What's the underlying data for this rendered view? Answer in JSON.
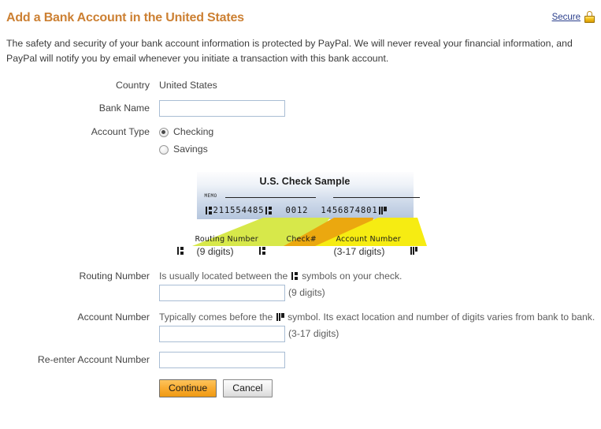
{
  "header": {
    "title": "Add a Bank Account in the United States",
    "secure_label": "Secure",
    "lock_icon": "padlock-icon"
  },
  "intro": {
    "text": "The safety and security of your bank account information is protected by PayPal. We will never reveal your financial information, and PayPal will notify you by email whenever you initiate a transaction with this bank account."
  },
  "form": {
    "country": {
      "label": "Country",
      "value": "United States"
    },
    "bank_name": {
      "label": "Bank Name",
      "value": "",
      "placeholder": ""
    },
    "account_type": {
      "label": "Account Type",
      "options": [
        {
          "label": "Checking",
          "selected": true
        },
        {
          "label": "Savings",
          "selected": false
        }
      ]
    },
    "routing_number": {
      "label": "Routing Number",
      "hint_before": "Is usually located between the",
      "hint_after": "symbols on your check.",
      "value": "",
      "digits_note": "(9 digits)"
    },
    "account_number": {
      "label": "Account Number",
      "hint_before": "Typically comes before the",
      "hint_after": "symbol. Its exact location and number of digits varies from bank to bank.",
      "value": "",
      "digits_note": "(3-17 digits)"
    },
    "reenter_account_number": {
      "label": "Re-enter Account Number",
      "value": ""
    }
  },
  "check_sample": {
    "title": "U.S. Check Sample",
    "memo_label": "MEMO",
    "micr": {
      "routing": "211554485",
      "check_number": "0012",
      "account": "1456874801"
    },
    "bands": [
      {
        "label": "Routing Number",
        "color": "#d7e84a"
      },
      {
        "label": "Check#",
        "color": "#eba80f"
      },
      {
        "label": "Account Number",
        "color": "#f6ec12"
      }
    ],
    "digits_row": {
      "routing_digits": "(9 digits)",
      "account_digits": "(3-17 digits)"
    }
  },
  "buttons": {
    "continue_label": "Continue",
    "cancel_label": "Cancel"
  },
  "colors": {
    "title": "#cc8033",
    "link": "#2b3f8c",
    "input_border": "#a9bdd4",
    "primary_button": "#f9ad33"
  }
}
